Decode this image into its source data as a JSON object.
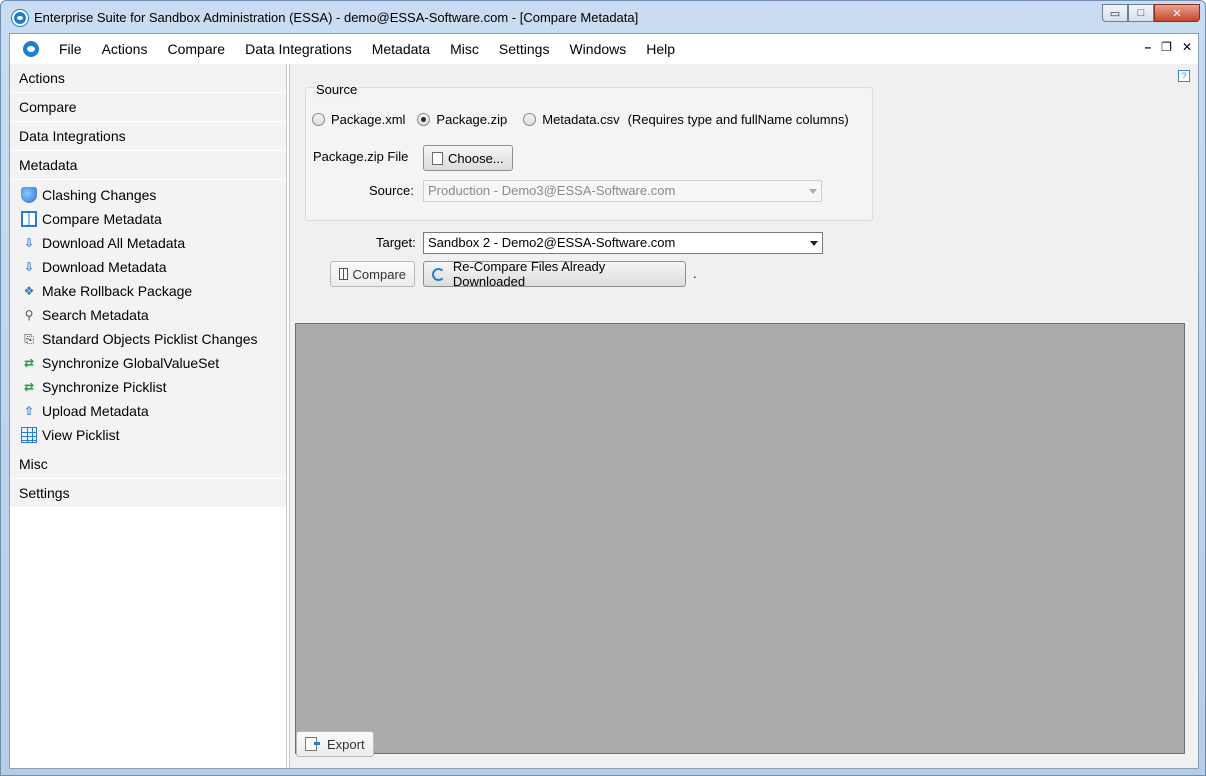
{
  "window": {
    "title": "Enterprise Suite for Sandbox Administration (ESSA) - demo@ESSA-Software.com - [Compare Metadata]",
    "min_glyph": "▭",
    "max_glyph": "□",
    "close_glyph": "✕"
  },
  "menubar": {
    "items": [
      "File",
      "Actions",
      "Compare",
      "Data Integrations",
      "Metadata",
      "Misc",
      "Settings",
      "Windows",
      "Help"
    ],
    "mdi_min": "–",
    "mdi_restore": "❐",
    "mdi_close": "✕"
  },
  "sidebar": {
    "groups_top": [
      "Actions",
      "Compare",
      "Data Integrations",
      "Metadata"
    ],
    "metadata_items": [
      {
        "label": "Clashing Changes",
        "icon": "shield-icon"
      },
      {
        "label": "Compare Metadata",
        "icon": "compare-icon"
      },
      {
        "label": "Download All Metadata",
        "icon": "download-icon"
      },
      {
        "label": "Download Metadata",
        "icon": "download-icon"
      },
      {
        "label": "Make Rollback Package",
        "icon": "package-icon"
      },
      {
        "label": "Search Metadata",
        "icon": "search-icon"
      },
      {
        "label": "Standard Objects Picklist Changes",
        "icon": "document-icon"
      },
      {
        "label": "Synchronize GlobalValueSet",
        "icon": "sync-icon"
      },
      {
        "label": "Synchronize Picklist",
        "icon": "sync-icon"
      },
      {
        "label": "Upload Metadata",
        "icon": "upload-icon"
      },
      {
        "label": "View Picklist",
        "icon": "grid-icon"
      }
    ],
    "groups_bottom": [
      "Misc",
      "Settings"
    ]
  },
  "main": {
    "help_glyph": "?",
    "source": {
      "legend": "Source",
      "options": [
        "Package.xml",
        "Package.zip",
        "Metadata.csv"
      ],
      "selected_index": 1,
      "csv_note": "(Requires type and fullName columns)",
      "file_label": "Package.zip File",
      "choose_button": "Choose...",
      "source_label": "Source:",
      "source_value": "Production - Demo3@ESSA-Software.com"
    },
    "target_label": "Target:",
    "target_value": "Sandbox 2 - Demo2@ESSA-Software.com",
    "compare_button": "Compare",
    "recompare_button": "Re-Compare Files Already Downloaded",
    "trailing_dot": ".",
    "export_button": "Export"
  }
}
